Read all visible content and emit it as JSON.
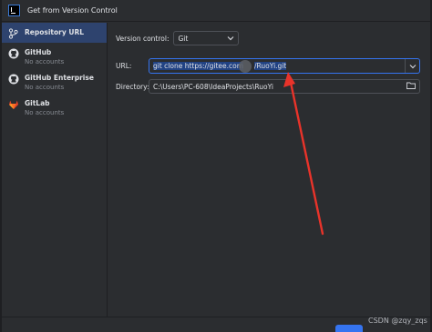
{
  "window": {
    "title": "Get from Version Control"
  },
  "sidebar": {
    "items": [
      {
        "label": "Repository URL",
        "sub": ""
      },
      {
        "label": "GitHub",
        "sub": "No accounts"
      },
      {
        "label": "GitHub Enterprise",
        "sub": "No accounts"
      },
      {
        "label": "GitLab",
        "sub": "No accounts"
      }
    ]
  },
  "form": {
    "version_control_label": "Version control:",
    "version_control_value": "Git",
    "url_label": "URL:",
    "url_value_before": "git clone https://gitee.com",
    "url_value_after": "/RuoYi.git",
    "directory_label": "Directory:",
    "directory_value": "C:\\Users\\PC-608\\IdeaProjects\\RuoYi"
  },
  "footer": {
    "watermark": "CSDN @zqy_zqs"
  },
  "colors": {
    "accent": "#3574f0",
    "sidebar_active": "#2e436e",
    "annotation": "#e8332a"
  },
  "icons": [
    "app-icon",
    "repository-url-icon",
    "github-icon",
    "github-enterprise-icon",
    "gitlab-icon",
    "chevron-down-icon",
    "folder-icon"
  ]
}
